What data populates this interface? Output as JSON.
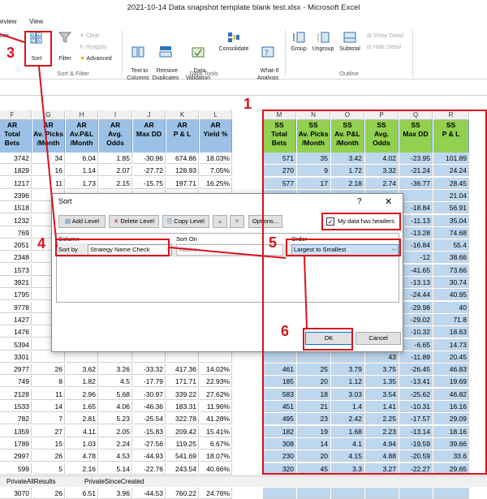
{
  "window": {
    "title": "2021-10-14 Data snapshot template blank test.xlsx  -  Microsoft Excel"
  },
  "ribbon_tabs": [
    {
      "label": "eview"
    },
    {
      "label": "View"
    }
  ],
  "ribbon": {
    "left_cut": "ons",
    "sort_label": "Sort",
    "filter_label": "Filter",
    "clear_label": "Clear",
    "reapply_label": "Reapply",
    "advanced_label": "Advanced",
    "text_to_columns_label": "Text to\nColumns",
    "remove_duplicates_label": "Remove\nDuplicates",
    "data_validation_label": "Data\nValidation",
    "consolidate_label": "Consolidate",
    "whatif_label": "What-If\nAnalysis",
    "group_label": "Group",
    "ungroup_label": "Ungroup",
    "subtotal_label": "Subtotal",
    "show_detail_label": "Show Detail",
    "hide_detail_label": "Hide Detail",
    "groups": {
      "sort_filter": "Sort & Filter",
      "data_tools": "Data Tools",
      "outline": "Outline"
    }
  },
  "columns": [
    "F",
    "G",
    "H",
    "I",
    "J",
    "K",
    "L",
    "M",
    "N",
    "O",
    "P",
    "Q",
    "R"
  ],
  "headers": [
    "AR\nTotal\nBets",
    "AR\nAv. Picks\n/Month",
    "AR\nAv.P&L\n/Month",
    "AR\nAvg.\nOdds",
    "AR\nMax DD",
    "AR\nP & L",
    "AR\nYield %",
    "SS\nTotal\nBets",
    "SS\nAv. Picks\n/Month",
    "SS\nAv. P&L\n/Month",
    "SS\nAvg.\nOdds",
    "SS\nMax DD",
    "SS\nP & L"
  ],
  "rows": [
    [
      "3742",
      "34",
      "6.04",
      "1.85",
      "-30.96",
      "674.86",
      "18.03%",
      "571",
      "35",
      "3.42",
      "4.02",
      "-23.95",
      "101.89"
    ],
    [
      "1829",
      "16",
      "1.14",
      "2.07",
      "-27.72",
      "128.93",
      "7.05%",
      "270",
      "9",
      "1.72",
      "3.32",
      "-21.24",
      "24.24"
    ],
    [
      "1217",
      "11",
      "1.73",
      "2.15",
      "-15.75",
      "197.71",
      "16.25%",
      "577",
      "17",
      "2.18",
      "2.74",
      "-36.77",
      "28.45"
    ],
    [
      "2396",
      "",
      "",
      "",
      "",
      "",
      "",
      "",
      "",
      "",
      "-7.53",
      "",
      "21.04"
    ],
    [
      "1518",
      "",
      "",
      "",
      "",
      "",
      "",
      "",
      "",
      "",
      "1.9",
      "-18.84",
      "56.91"
    ],
    [
      "1232",
      "",
      "",
      "",
      "",
      "",
      "",
      "",
      "",
      "",
      "9",
      "-11.13",
      "35.04"
    ],
    [
      "769",
      "",
      "",
      "",
      "",
      "",
      "",
      "",
      "",
      "",
      "3",
      "-13.28",
      "74.68"
    ],
    [
      "2051",
      "",
      "",
      "",
      "",
      "",
      "",
      "",
      "",
      "",
      "6",
      "-16.84",
      "55.4"
    ],
    [
      "2348",
      "",
      "",
      "",
      "",
      "",
      "",
      "",
      "",
      "",
      "59",
      "-12",
      "38.66"
    ],
    [
      "1573",
      "",
      "",
      "",
      "",
      "",
      "",
      "",
      "",
      "",
      "52",
      "-41.65",
      "73.66"
    ],
    [
      "3921",
      "",
      "",
      "",
      "",
      "",
      "",
      "",
      "",
      "",
      "27",
      "-13.13",
      "30.74"
    ],
    [
      "1795",
      "",
      "",
      "",
      "",
      "",
      "",
      "",
      "",
      "",
      "53",
      "-24.44",
      "40.95"
    ],
    [
      "9778",
      "",
      "",
      "",
      "",
      "",
      "",
      "",
      "",
      "",
      "57",
      "-29.98",
      "40"
    ],
    [
      "1427",
      "",
      "",
      "",
      "",
      "",
      "",
      "",
      "",
      "",
      "07",
      "-29.02",
      "71.8"
    ],
    [
      "1476",
      "",
      "",
      "",
      "",
      "",
      "",
      "",
      "",
      "",
      "89",
      "-10.32",
      "18.63"
    ],
    [
      "5394",
      "",
      "",
      "",
      "",
      "",
      "",
      "",
      "",
      "",
      "05",
      "-6.65",
      "14.73"
    ],
    [
      "3301",
      "",
      "",
      "",
      "",
      "",
      "",
      "",
      "",
      "",
      "43",
      "-11.89",
      "20.45"
    ],
    [
      "2977",
      "26",
      "3.62",
      "3.26",
      "-33.32",
      "417.36",
      "14.02%",
      "461",
      "25",
      "3.79",
      "3.75",
      "-26.45",
      "46.83"
    ],
    [
      "749",
      "8",
      "1.82",
      "4.5",
      "-17.79",
      "171.71",
      "22.93%",
      "185",
      "20",
      "1.12",
      "1.35",
      "-13.41",
      "19.69"
    ],
    [
      "2128",
      "11",
      "2.96",
      "5.68",
      "-30.97",
      "339.22",
      "27.62%",
      "583",
      "18",
      "3.03",
      "3.54",
      "-25.62",
      "46.82"
    ],
    [
      "1533",
      "14",
      "1.65",
      "4.06",
      "-46.36",
      "183.31",
      "11.96%",
      "451",
      "21",
      "1.4",
      "1.41",
      "-10.31",
      "16.16"
    ],
    [
      "782",
      "7",
      "2.81",
      "5.23",
      "-25.54",
      "322.78",
      "41.28%",
      "495",
      "23",
      "2.42",
      "2.25",
      "-17.57",
      "29.09"
    ],
    [
      "1359",
      "27",
      "4.11",
      "2.05",
      "-15.83",
      "209.42",
      "15.41%",
      "182",
      "19",
      "1.68",
      "2.23",
      "-13.14",
      "18.16"
    ],
    [
      "1789",
      "15",
      "1.03",
      "2.24",
      "-27.56",
      "119.25",
      "6.67%",
      "308",
      "14",
      "4.1",
      "4.94",
      "-19.59",
      "39.66"
    ],
    [
      "2997",
      "26",
      "4.78",
      "4.53",
      "-44.93",
      "541.69",
      "18.07%",
      "230",
      "20",
      "4.15",
      "4.88",
      "-20.59",
      "33.6"
    ],
    [
      "599",
      "5",
      "2.16",
      "5.14",
      "-22.76",
      "243.54",
      "40.66%",
      "320",
      "45",
      "3.3",
      "3.27",
      "-22.27",
      "29.65"
    ],
    [
      "3789",
      "33",
      "3.39",
      "4.24",
      "-35.28",
      "389.62",
      "10.28%",
      "739",
      "58",
      "6.36",
      "4.66",
      "-21",
      "32.6"
    ],
    [
      "3070",
      "26",
      "6.51",
      "3.96",
      "-44.53",
      "760.22",
      "24.76%",
      "",
      "",
      "",
      "",
      "",
      ""
    ]
  ],
  "dialog": {
    "title": "Sort",
    "help": "?",
    "close": "✕",
    "add_level": "Add Level",
    "delete_level": "Delete Level",
    "copy_level": "Copy Level",
    "options": "Options...",
    "has_headers": "My data has headers",
    "has_headers_checked": true,
    "col_header": "Column",
    "sorton_header": "Sort On",
    "order_header": "Order",
    "sort_by": "Sort by",
    "column_value": "Strategy Name Check",
    "sorton_value": "Values",
    "order_value": "Largest to Smallest",
    "ok": "OK",
    "cancel": "Cancel"
  },
  "steps": [
    "1",
    "3",
    "4",
    "5",
    "6"
  ],
  "sheet_tabs": [
    "PrivateAllResults",
    "PrivateSinceCreated"
  ],
  "colors": {
    "ar_header": "#9bc2e6",
    "ss_header": "#92d050",
    "ss_cells": "#bdd7ee",
    "red": "#d9121b"
  }
}
